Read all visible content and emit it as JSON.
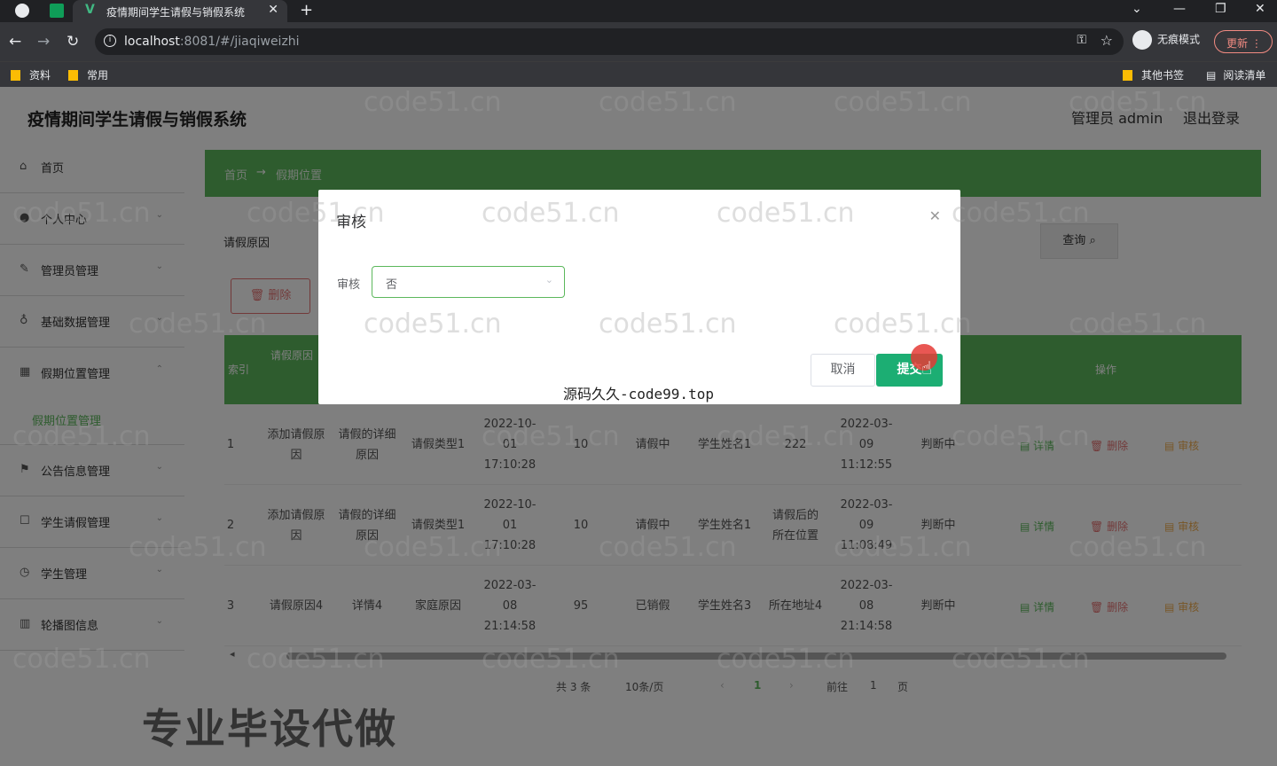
{
  "browser": {
    "tab_title": "疫情期间学生请假与销假系统",
    "url_host": "localhost",
    "url_rest": ":8081/#/jiaqiweizhi",
    "incognito_label": "无痕模式",
    "update_label": "更新",
    "bookmarks": [
      "资料",
      "常用"
    ],
    "bookmarks_right": [
      "其他书签",
      "阅读清单"
    ]
  },
  "header": {
    "title": "疫情期间学生请假与销假系统",
    "admin_label": "管理员 admin",
    "logout_label": "退出登录"
  },
  "sidebar": {
    "items": [
      {
        "label": "首页",
        "icon": "home-icon"
      },
      {
        "label": "个人中心",
        "icon": "user-icon"
      },
      {
        "label": "管理员管理",
        "icon": "edit-icon"
      },
      {
        "label": "基础数据管理",
        "icon": "mic-icon"
      },
      {
        "label": "假期位置管理",
        "icon": "grid-icon"
      },
      {
        "label": "公告信息管理",
        "icon": "flag-icon"
      },
      {
        "label": "学生请假管理",
        "icon": "doc-icon"
      },
      {
        "label": "学生管理",
        "icon": "clock-icon"
      },
      {
        "label": "轮播图信息",
        "icon": "chart-icon"
      }
    ],
    "active_sub": "假期位置管理"
  },
  "breadcrumb": {
    "home": "首页",
    "arrow": "→",
    "current": "假期位置"
  },
  "search": {
    "label": "请假原因",
    "query_button": "查询"
  },
  "toolbar": {
    "delete_button": "删除"
  },
  "table": {
    "headers": [
      "索引",
      "请假原因",
      "操作"
    ],
    "rows": [
      {
        "idx": "1",
        "reason": "添加请假原因",
        "detail": "请假的详细原因",
        "type": "请假类型1",
        "time": "2022-10-01 17:10:28",
        "days": "10",
        "status": "请假中",
        "student": "学生姓名1",
        "location": "222",
        "created": "2022-03-09 11:12:55",
        "judge": "判断中"
      },
      {
        "idx": "2",
        "reason": "添加请假原因",
        "detail": "请假的详细原因",
        "type": "请假类型1",
        "time": "2022-10-01 17:10:28",
        "days": "10",
        "status": "请假中",
        "student": "学生姓名1",
        "location": "请假后的所在位置",
        "created": "2022-03-09 11:08:49",
        "judge": "判断中"
      },
      {
        "idx": "3",
        "reason": "请假原因4",
        "detail": "详情4",
        "type": "家庭原因",
        "time": "2022-03-08 21:14:58",
        "days": "95",
        "status": "已销假",
        "student": "学生姓名3",
        "location": "所在地址4",
        "created": "2022-03-08 21:14:58",
        "judge": "判断中"
      }
    ],
    "action_detail": "详情",
    "action_delete": "删除",
    "action_audit": "审核"
  },
  "pagination": {
    "total": "共 3 条",
    "page_size": "10条/页",
    "current": "1",
    "goto_label": "前往",
    "goto_value": "1",
    "page_unit": "页"
  },
  "dialog": {
    "title": "审核",
    "field_label": "审核",
    "select_value": "否",
    "cancel_label": "取消",
    "submit_label": "提交"
  },
  "caption": "源码久久-code99.top",
  "promo_text": "专业毕设代做",
  "watermark_text": "code51.cn"
}
